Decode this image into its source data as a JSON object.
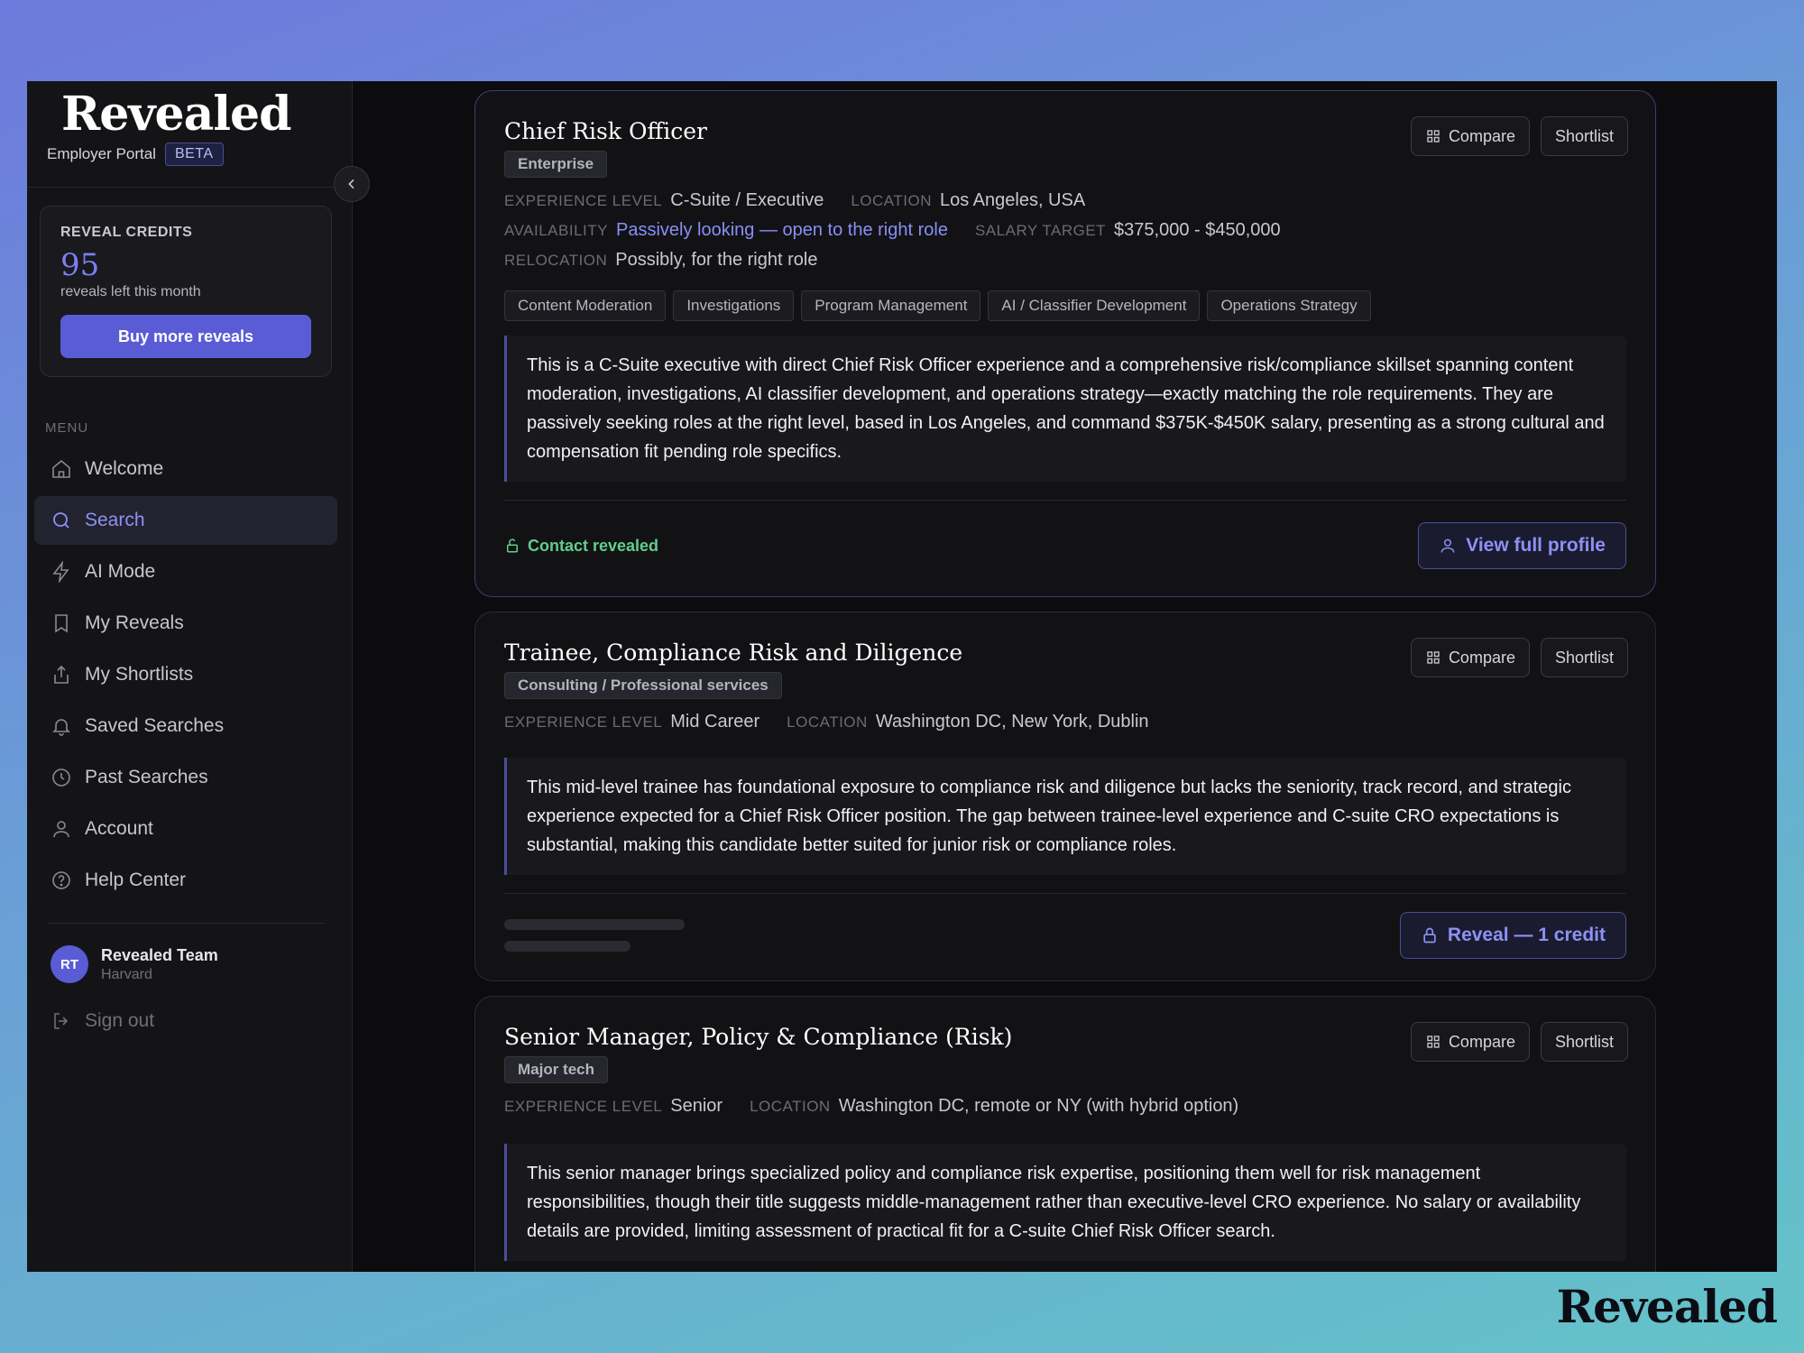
{
  "brand": {
    "logo": "Revealed",
    "portal": "Employer Portal",
    "beta": "BETA"
  },
  "credits": {
    "title": "REVEAL CREDITS",
    "count": "95",
    "subtitle": "reveals left this month",
    "buy_label": "Buy more reveals"
  },
  "menu": {
    "label": "MENU",
    "items": [
      {
        "label": "Welcome",
        "icon": "home-icon"
      },
      {
        "label": "Search",
        "icon": "search-icon",
        "active": true
      },
      {
        "label": "AI Mode",
        "icon": "bolt-icon"
      },
      {
        "label": "My Reveals",
        "icon": "bookmark-icon"
      },
      {
        "label": "My Shortlists",
        "icon": "share-icon"
      },
      {
        "label": "Saved Searches",
        "icon": "bell-icon"
      },
      {
        "label": "Past Searches",
        "icon": "clock-icon"
      },
      {
        "label": "Account",
        "icon": "user-icon"
      },
      {
        "label": "Help Center",
        "icon": "help-icon"
      }
    ]
  },
  "user": {
    "initials": "RT",
    "name": "Revealed Team",
    "org": "Harvard"
  },
  "signout_label": "Sign out",
  "labels": {
    "compare": "Compare",
    "shortlist": "Shortlist",
    "experience": "EXPERIENCE LEVEL",
    "location": "LOCATION",
    "availability": "AVAILABILITY",
    "salary": "SALARY TARGET",
    "relocation": "RELOCATION"
  },
  "candidates": [
    {
      "title": "Chief Risk Officer",
      "badge": "Enterprise",
      "experience": "C-Suite / Executive",
      "location": "Los Angeles, USA",
      "availability": "Passively looking — open to the right role",
      "salary": "$375,000 - $450,000",
      "relocation": "Possibly, for the right role",
      "tags": [
        "Content Moderation",
        "Investigations",
        "Program Management",
        "AI / Classifier Development",
        "Operations Strategy"
      ],
      "summary": "This is a C-Suite executive with direct Chief Risk Officer experience and a comprehensive risk/compliance skillset spanning content moderation, investigations, AI classifier development, and operations strategy—exactly matching the role requirements. They are passively seeking roles at the right level, based in Los Angeles, and command $375K-$450K salary, presenting as a strong cultural and compensation fit pending role specifics.",
      "status": "Contact revealed",
      "action": "View full profile"
    },
    {
      "title": "Trainee, Compliance Risk and Diligence",
      "badge": "Consulting / Professional services",
      "experience": "Mid Career",
      "location": "Washington DC, New York, Dublin",
      "summary": "This mid-level trainee has foundational exposure to compliance risk and diligence but lacks the seniority, track record, and strategic experience expected for a Chief Risk Officer position. The gap between trainee-level experience and C-suite CRO expectations is substantial, making this candidate better suited for junior risk or compliance roles.",
      "action": "Reveal — 1 credit"
    },
    {
      "title": "Senior Manager, Policy & Compliance (Risk)",
      "badge": "Major tech",
      "experience": "Senior",
      "location": "Washington DC, remote or NY (with hybrid option)",
      "summary": "This senior manager brings specialized policy and compliance risk expertise, positioning them well for risk management responsibilities, though their title suggests middle-management rather than executive-level CRO experience. No salary or availability details are provided, limiting assessment of practical fit for a C-suite Chief Risk Officer search."
    }
  ],
  "watermark": "Revealed"
}
